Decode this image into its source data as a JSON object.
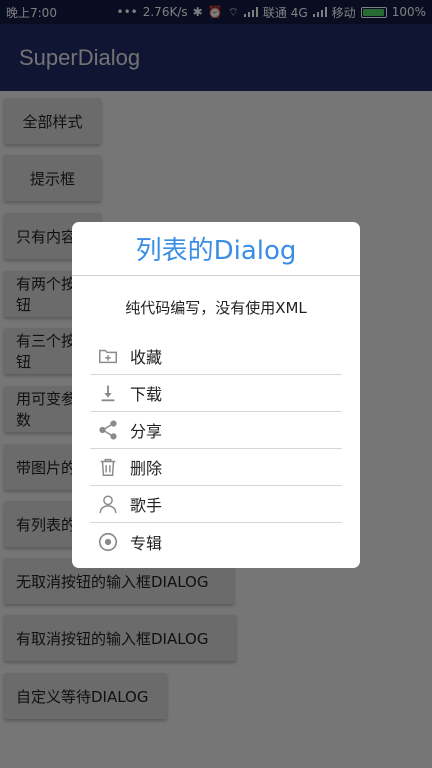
{
  "status_bar": {
    "time": "晚上7:00",
    "speed": "2.76K/s",
    "carrier1": "联通 4G",
    "carrier2": "移动",
    "battery": "100%"
  },
  "app_bar": {
    "title": "SuperDialog"
  },
  "buttons": [
    {
      "label": "全部样式"
    },
    {
      "label": "提示框"
    },
    {
      "label": "只有内容"
    },
    {
      "label": "有两个按钮"
    },
    {
      "label": "有三个按钮"
    },
    {
      "label": "用可变参数"
    },
    {
      "label": "带图片的"
    },
    {
      "label": "有列表的"
    },
    {
      "label": "无取消按钮的输入框DIALOG"
    },
    {
      "label": "有取消按钮的输入框DIALOG"
    },
    {
      "label": "自定义等待DIALOG"
    }
  ],
  "dialog": {
    "title": "列表的Dialog",
    "content": "纯代码编写，没有使用XML",
    "items": [
      {
        "label": "收藏",
        "icon": "folder-add-icon"
      },
      {
        "label": "下载",
        "icon": "download-icon"
      },
      {
        "label": "分享",
        "icon": "share-icon"
      },
      {
        "label": "删除",
        "icon": "trash-icon"
      },
      {
        "label": "歌手",
        "icon": "person-icon"
      },
      {
        "label": "专辑",
        "icon": "disc-icon"
      }
    ],
    "title_color": "#3a8ee6",
    "icon_color": "#8a8a8a"
  },
  "colors": {
    "status_bar": "#101a44",
    "app_bar": "#1e2a66",
    "button_bg": "#d6d6d6",
    "page_bg": "#ececec"
  }
}
